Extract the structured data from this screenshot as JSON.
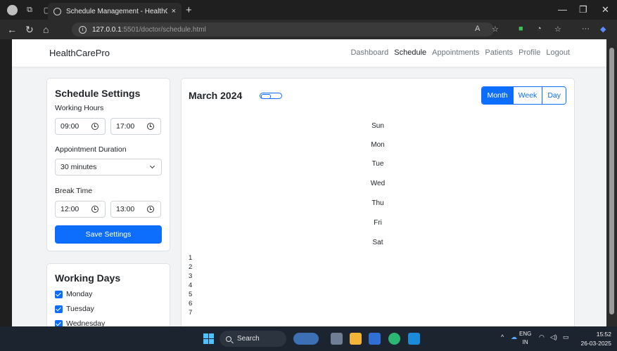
{
  "browser": {
    "tab_title": "Schedule Management - HealthC",
    "tab_close": "×",
    "new_tab": "+",
    "url_host": "127.0.0.1",
    "url_rest": ":5501/doctor/schedule.html",
    "icons": [
      "profile-icon",
      "workspaces-icon",
      "tab-actions-icon",
      "globe-icon",
      "back-icon",
      "refresh-icon",
      "home-icon",
      "info-icon",
      "read-aloud-icon",
      "favorite-icon",
      "extension-icon",
      "collections-icon",
      "favorites-bar-icon",
      "more-icon",
      "copilot-icon"
    ]
  },
  "navbar": {
    "brand": "HealthCarePro",
    "links": [
      "Dashboard",
      "Schedule",
      "Appointments",
      "Patients",
      "Profile",
      "Logout"
    ],
    "active": "Schedule"
  },
  "settings": {
    "title": "Schedule Settings",
    "working_hours_label": "Working Hours",
    "work_start": "09:00",
    "work_end": "17:00",
    "duration_label": "Appointment Duration",
    "duration_value": "30 minutes",
    "break_label": "Break Time",
    "break_start": "12:00",
    "break_end": "13:00",
    "save_label": "Save Settings"
  },
  "working_days": {
    "title": "Working Days",
    "days": [
      "Monday",
      "Tuesday",
      "Wednesday"
    ]
  },
  "calendar": {
    "month_title": "March 2024",
    "views": [
      "Month",
      "Week",
      "Day"
    ],
    "active_view": "Month",
    "weekdays": [
      "Sun",
      "Mon",
      "Tue",
      "Wed",
      "Thu",
      "Fri",
      "Sat"
    ],
    "day_numbers": [
      "1",
      "2",
      "3",
      "4",
      "5",
      "6",
      "7"
    ]
  },
  "taskbar": {
    "search_label": "Search",
    "lang_top": "ENG",
    "lang_bottom": "IN",
    "time": "15:52",
    "date": "26-03-2025"
  },
  "colors": {
    "primary": "#0d6efd",
    "page_bg": "#f1f3f5"
  }
}
